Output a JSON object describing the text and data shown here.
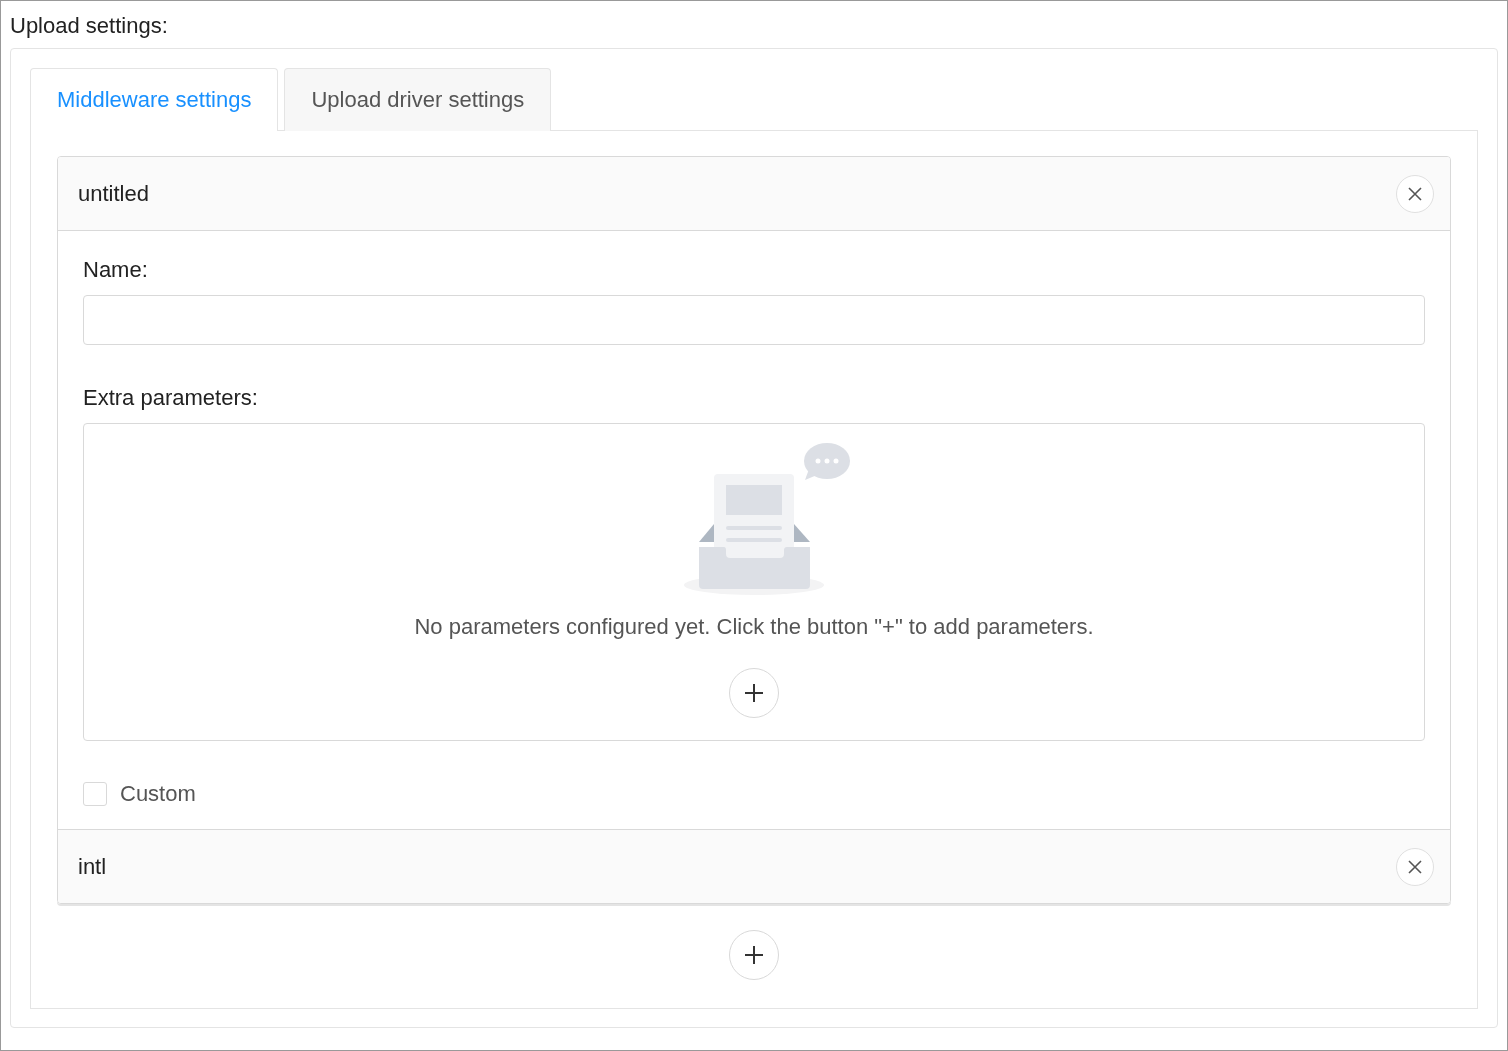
{
  "title": "Upload settings:",
  "tabs": [
    {
      "label": "Middleware settings",
      "selected": true
    },
    {
      "label": "Upload driver settings",
      "selected": false
    }
  ],
  "panels": [
    {
      "title": "untitled",
      "expanded": true,
      "name_label": "Name:",
      "params_label": "Extra parameters:",
      "empty_text": "No parameters configured yet. Click the button \"+\" to add parameters.",
      "custom": {
        "label": "Custom",
        "checked": false
      }
    },
    {
      "title": "intl",
      "expanded": false
    }
  ]
}
